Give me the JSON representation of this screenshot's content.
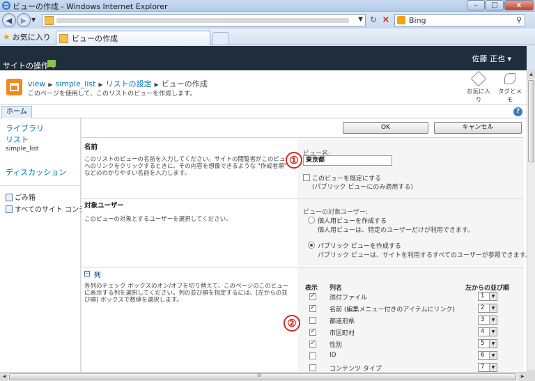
{
  "window": {
    "title": "ビューの作成 - Windows Internet Explorer",
    "min": "–",
    "max": "□",
    "close": "x"
  },
  "browser": {
    "search_label": "Bing",
    "favorites_label": "お気に入り",
    "tab_title": "ビューの作成"
  },
  "ribbon": {
    "site_actions": "サイトの操作 ▾",
    "user_name": "佐藤 正也 ▾",
    "home_tab": "ホーム",
    "help": "?"
  },
  "title_area": {
    "breadcrumb": [
      "view",
      "simple_list",
      "リストの設定",
      "ビューの作成"
    ],
    "description": "このページを使用して、このリストのビューを作成します。",
    "like_label": "お気に入り",
    "tags_label": "タグとメモ"
  },
  "left_nav": {
    "library": "ライブラリ",
    "list": "リスト",
    "list_item": "simple_list",
    "discussion": "ディスカッション",
    "recycle": "ごみ箱",
    "all_content": "すべてのサイト コンテンツ"
  },
  "buttons": {
    "ok": "OK",
    "cancel": "キャンセル"
  },
  "name_section": {
    "heading": "名前",
    "description": "このリストのビューの名前を入力してください。サイトの閲覧者がこのビューへのリンクをクリックするときに、その内容を想像できるような \"作成者順\" などのわかりやすい名前を入力します。",
    "field_label": "ビュー名:",
    "view_name": "東京都",
    "default_check": "このビューを既定にする",
    "default_note": "(パブリック ビューにのみ適用する)",
    "default_checked": false
  },
  "audience_section": {
    "heading": "対象ユーザー",
    "description": "このビューの対象とするユーザーを選択してください。",
    "field_label": "ビューの対象ユーザー:",
    "options": [
      {
        "label": "個人用ビューを作成する",
        "note": "個人用ビューは、特定のユーザーだけが利用できます。",
        "selected": false
      },
      {
        "label": "パブリック ビューを作成する",
        "note": "パブリック ビューは、サイトを利用するすべてのユーザーが参照できます。",
        "selected": true
      }
    ]
  },
  "columns_section": {
    "toggle": "−",
    "heading": "列",
    "description": "各列のチェック ボックスのオン/オフを切り替えて、このページのこのビューに表示する列を選択してください。列の並び順を指定するには、[左からの並び順] ボックスで数値を選択します。",
    "headers": {
      "display": "表示",
      "name": "列名",
      "order": "左からの並び順"
    },
    "rows": [
      {
        "name": "添付ファイル",
        "checked": true,
        "order": "1"
      },
      {
        "name": "名前 (編集メニュー付きのアイテムにリンク)",
        "checked": true,
        "order": "2"
      },
      {
        "name": "都道府県",
        "checked": false,
        "order": "3"
      },
      {
        "name": "市区町村",
        "checked": true,
        "order": "4"
      },
      {
        "name": "性別",
        "checked": true,
        "order": "5"
      },
      {
        "name": "ID",
        "checked": false,
        "order": "6"
      },
      {
        "name": "コンテンツ タイプ",
        "checked": false,
        "order": "7"
      }
    ]
  },
  "callouts": [
    "①",
    "②"
  ],
  "scroll": {
    "h_grip": "III"
  }
}
